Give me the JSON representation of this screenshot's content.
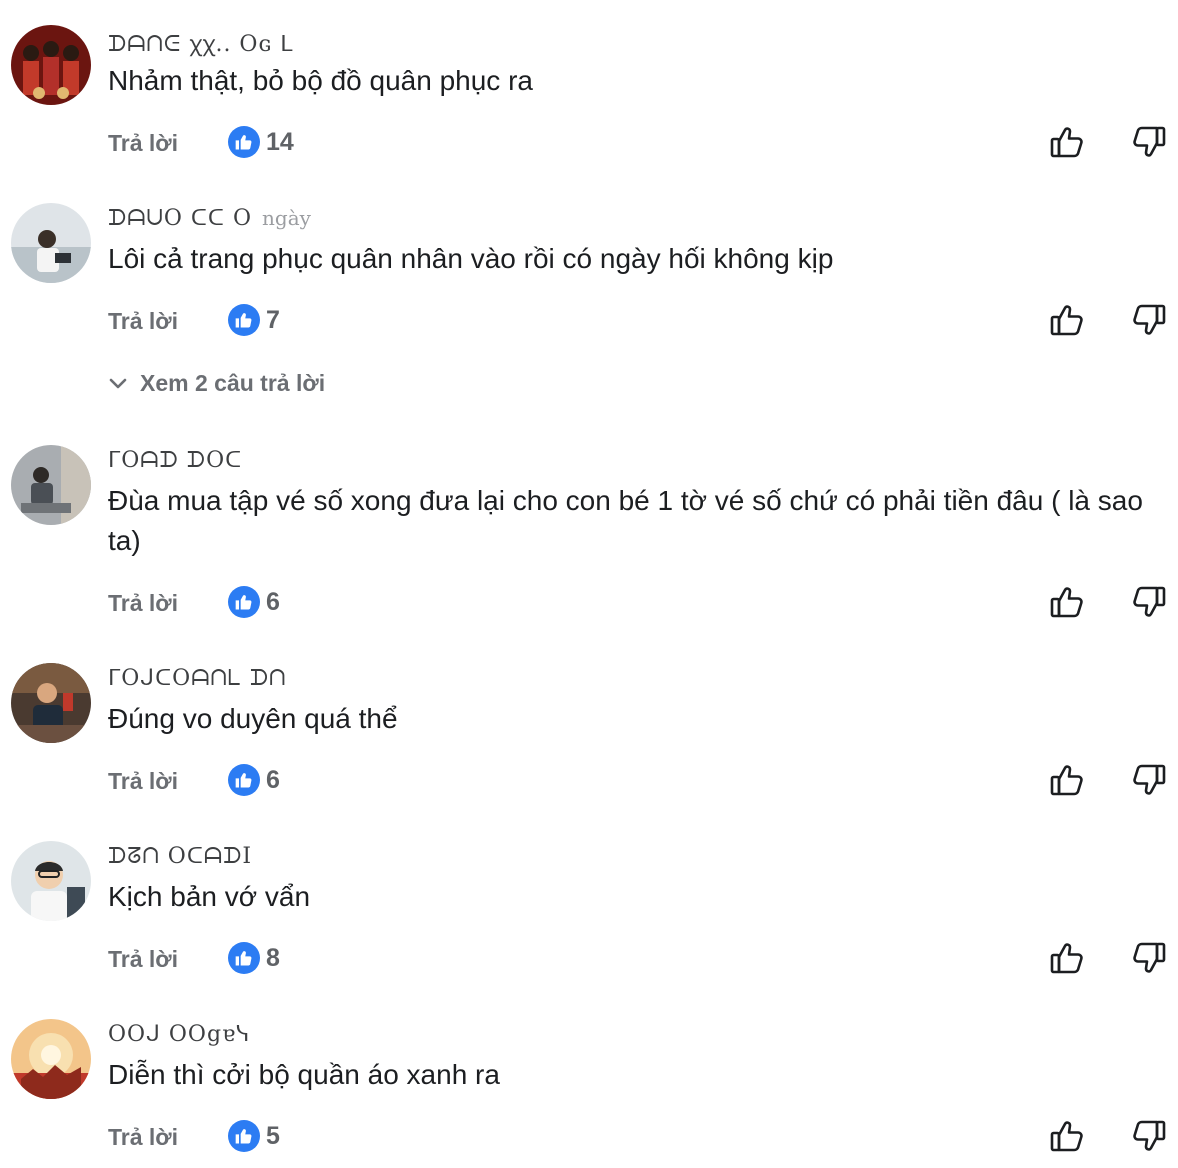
{
  "comments": [
    {
      "author": "ᗪᗩᑎᕮ ꭓꭓ.. Oɢ ᒪ",
      "time": "",
      "text": "Nhảm thật, bỏ bộ đồ quân phục ra",
      "reply_label": "Trả lời",
      "like_count": "14",
      "avatar_colors": [
        "#7a1a14",
        "#c23a2a",
        "#e0b870"
      ]
    },
    {
      "author": "ᗪᗩᑌO ᑕᑕ O",
      "time": "ngày",
      "text": "Lôi cả trang phục quân nhân vào rồi có ngày hối không kịp",
      "reply_label": "Trả lời",
      "like_count": "7",
      "avatar_colors": [
        "#c9d1d6",
        "#e6e9ec",
        "#3a3f44"
      ]
    },
    {
      "author": "ᒥOᗩᗪ ᗪOᑕ",
      "time": "",
      "text": "Đùa mua tập vé số xong đưa lại cho con bé 1 tờ vé số chứ có phải tiền đâu ( là sao ta)",
      "reply_label": "Trả lời",
      "like_count": "6",
      "avatar_colors": [
        "#8b8f94",
        "#c7c2bb",
        "#3d4247"
      ]
    },
    {
      "author": "ᒥOᒍᑕOᗩᑎᒪ ᗪᑎ",
      "time": "",
      "text": "Đúng vo duyên quá thể",
      "reply_label": "Trả lời",
      "like_count": "6",
      "avatar_colors": [
        "#5a3a2a",
        "#c0392b",
        "#2c3e50"
      ]
    },
    {
      "author": "ᗪᘔᑎ OᑕᗩᗪI",
      "time": "",
      "text": "Kịch bản vớ vẩn",
      "reply_label": "Trả lời",
      "like_count": "8",
      "avatar_colors": [
        "#cfd8dc",
        "#eceff1",
        "#37474f"
      ]
    },
    {
      "author": "OOᒍ OOgɐᓭ",
      "time": "",
      "text": "Diễn thì cởi bộ quần áo xanh ra",
      "reply_label": "Trả lời",
      "like_count": "5",
      "avatar_colors": [
        "#e67e22",
        "#f5cba7",
        "#c0392b"
      ]
    }
  ],
  "view_replies_label": "Xem 2 câu trả lời",
  "colors": {
    "like_bubble": "#2c7cf3",
    "muted_text": "#6b6e73",
    "body_text": "#1c1e21"
  },
  "icons": {
    "like_badge": "thumbs-up-icon",
    "thumb_up": "thumb-up-outline-icon",
    "thumb_down": "thumb-down-outline-icon",
    "expand": "chevron-down-icon"
  }
}
